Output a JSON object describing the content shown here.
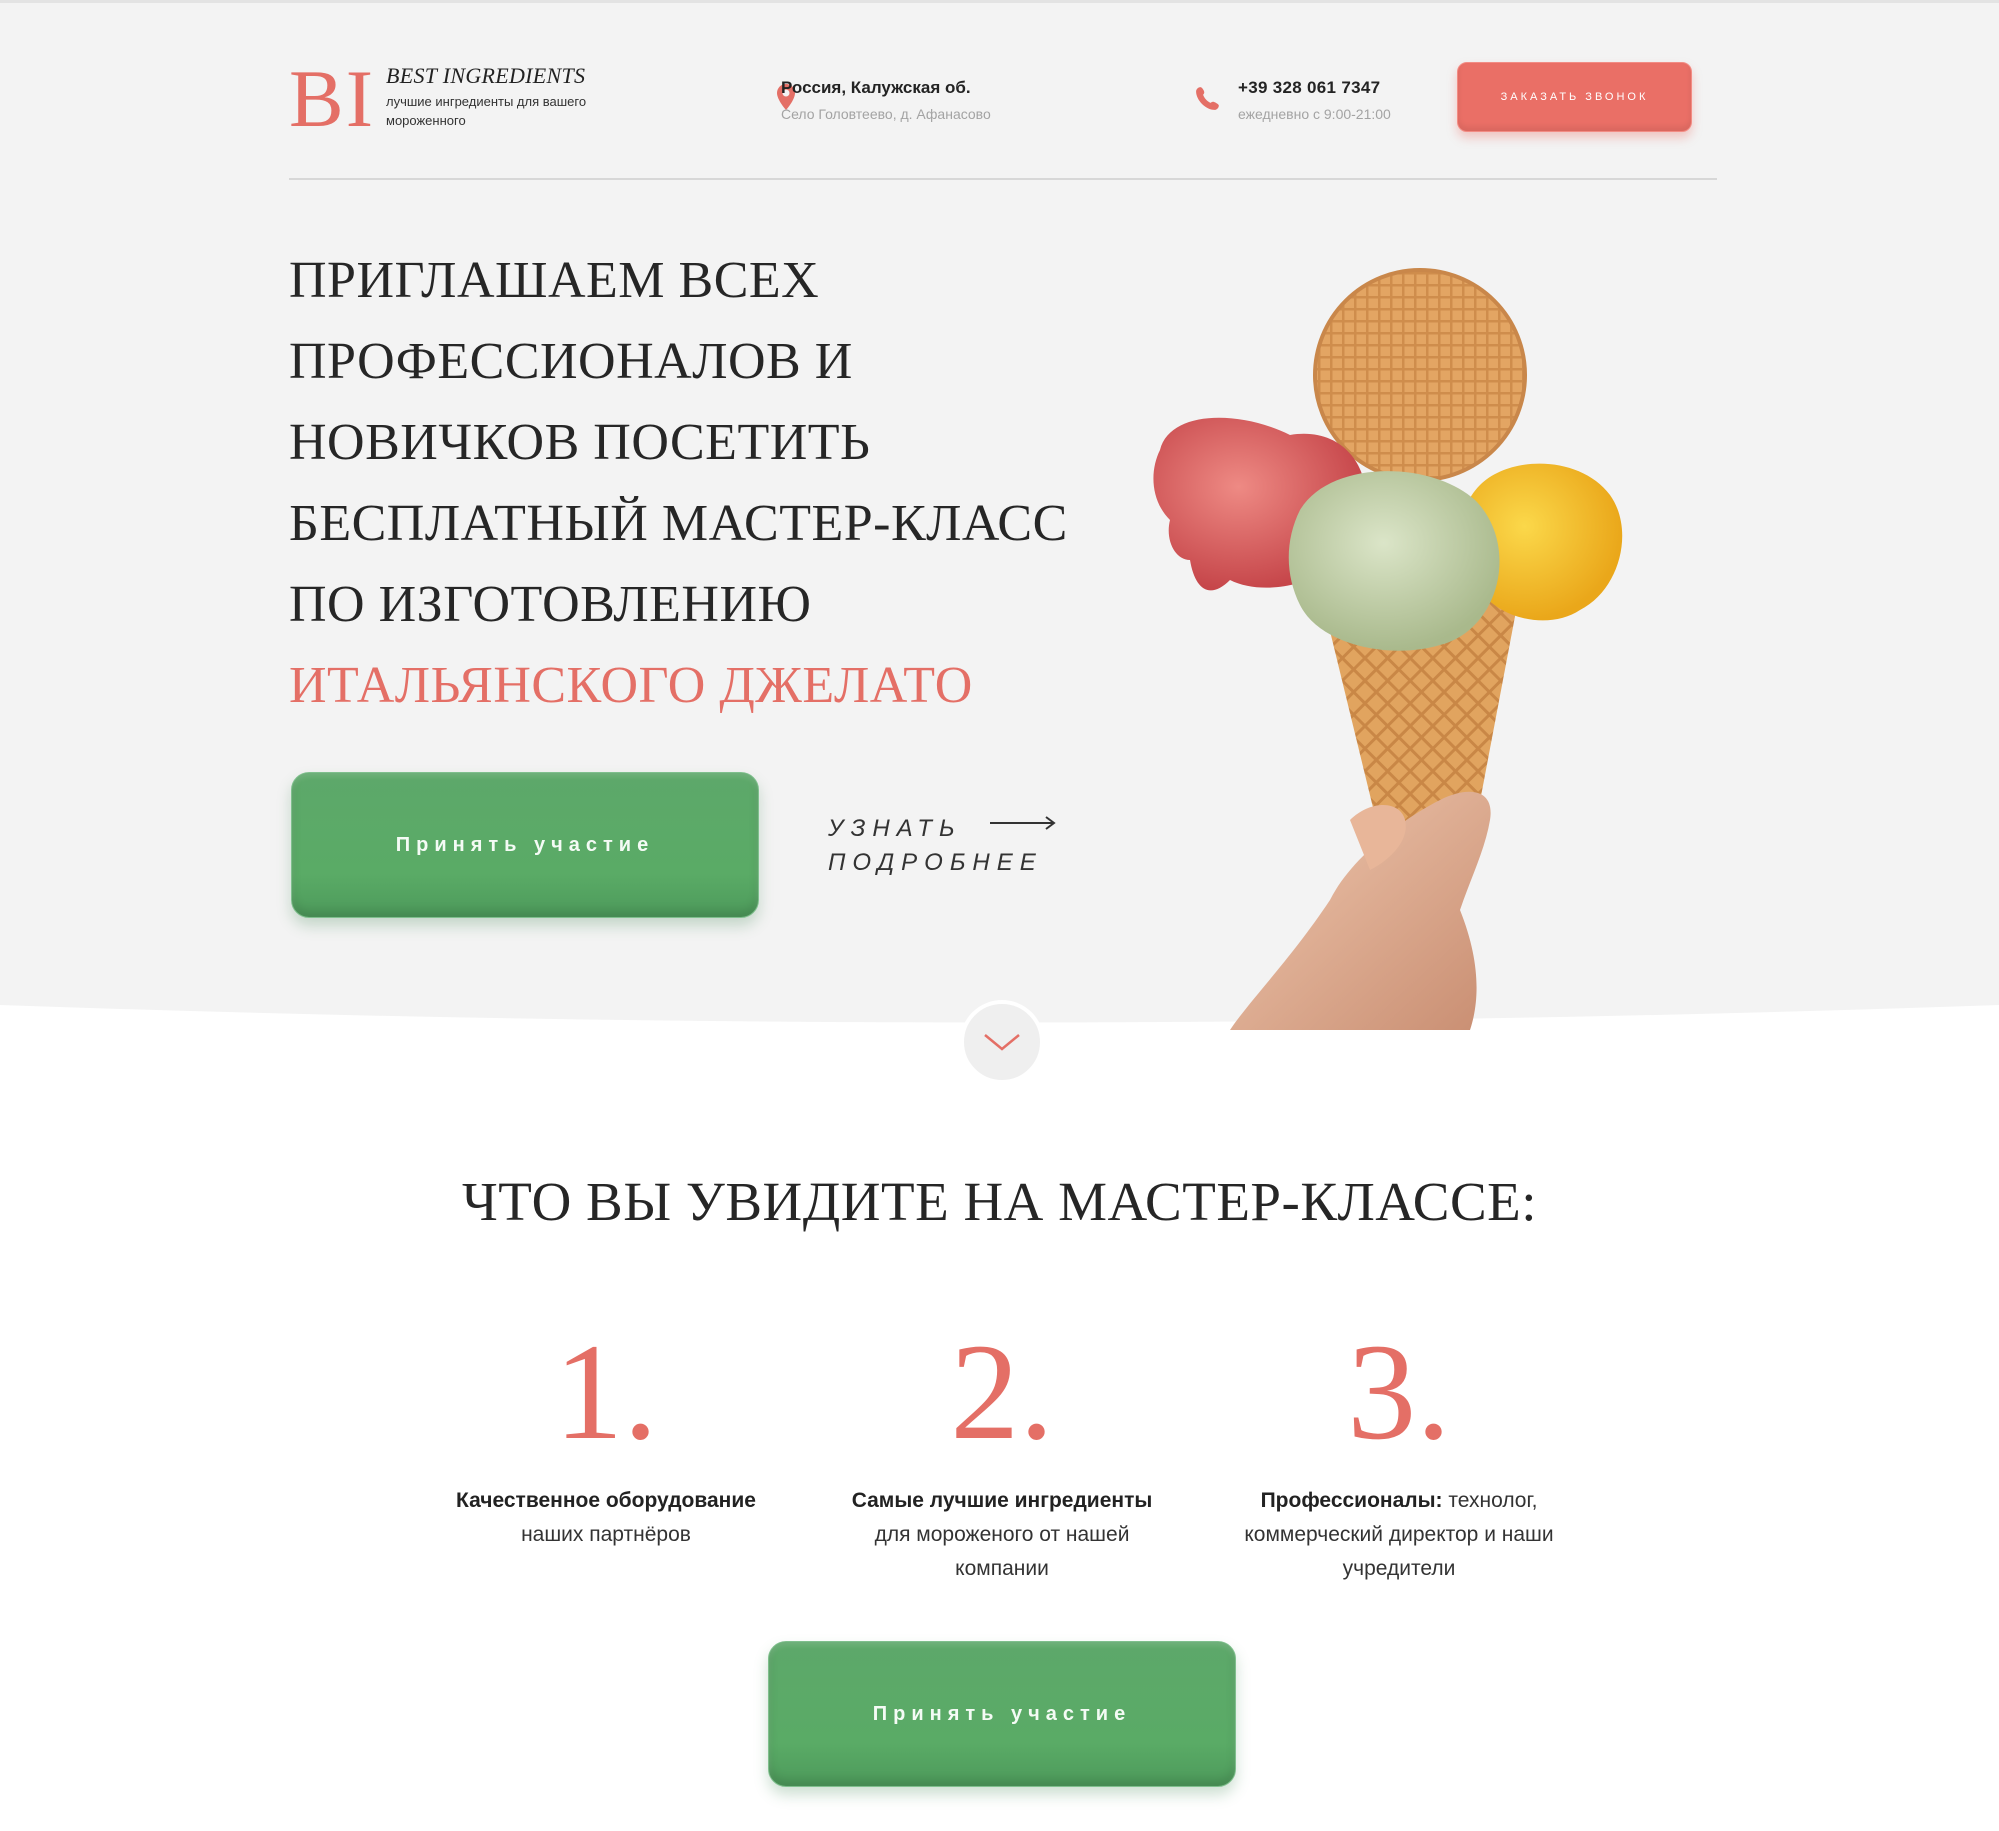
{
  "header": {
    "logo": "BI",
    "brand_name": "BEST INGREDIENTS",
    "brand_tagline": "лучшие ингредиенты для вашего мороженного",
    "location_main": "Россия, Калужская об.",
    "location_sub": "Село Головтеево, д. Афанасово",
    "phone_main": "+39 328 061 7347",
    "phone_sub": "ежедневно с 9:00-21:00",
    "callback_label": "Заказать звонок"
  },
  "hero": {
    "headline": "Приглашаем всех профессионалов и новичков посетить бесплатный мастер-класс по изготовлению",
    "headline_accent": "итальянского джелато",
    "cta_label": "Принять участие",
    "more_label": "Узнать подробнее"
  },
  "features": {
    "title": "Что вы увидите на мастер-классе:",
    "items": [
      {
        "num": "1.",
        "bold": "Качественное оборудование",
        "text": "наших партнёров"
      },
      {
        "num": "2.",
        "bold": "Самые лучшие ингредиенты",
        "text": "для мороженого от нашей компании"
      },
      {
        "num": "3.",
        "bold": "Профессионалы:",
        "text": "технолог, коммерческий директор и наши учредители"
      }
    ],
    "cta_label": "Принять участие"
  },
  "colors": {
    "accent": "#e46f66",
    "green": "#5aab66",
    "hero_bg": "#f3f3f3"
  },
  "icons": [
    "location-pin-icon",
    "phone-icon",
    "arrow-right-icon",
    "chevron-down-icon"
  ]
}
